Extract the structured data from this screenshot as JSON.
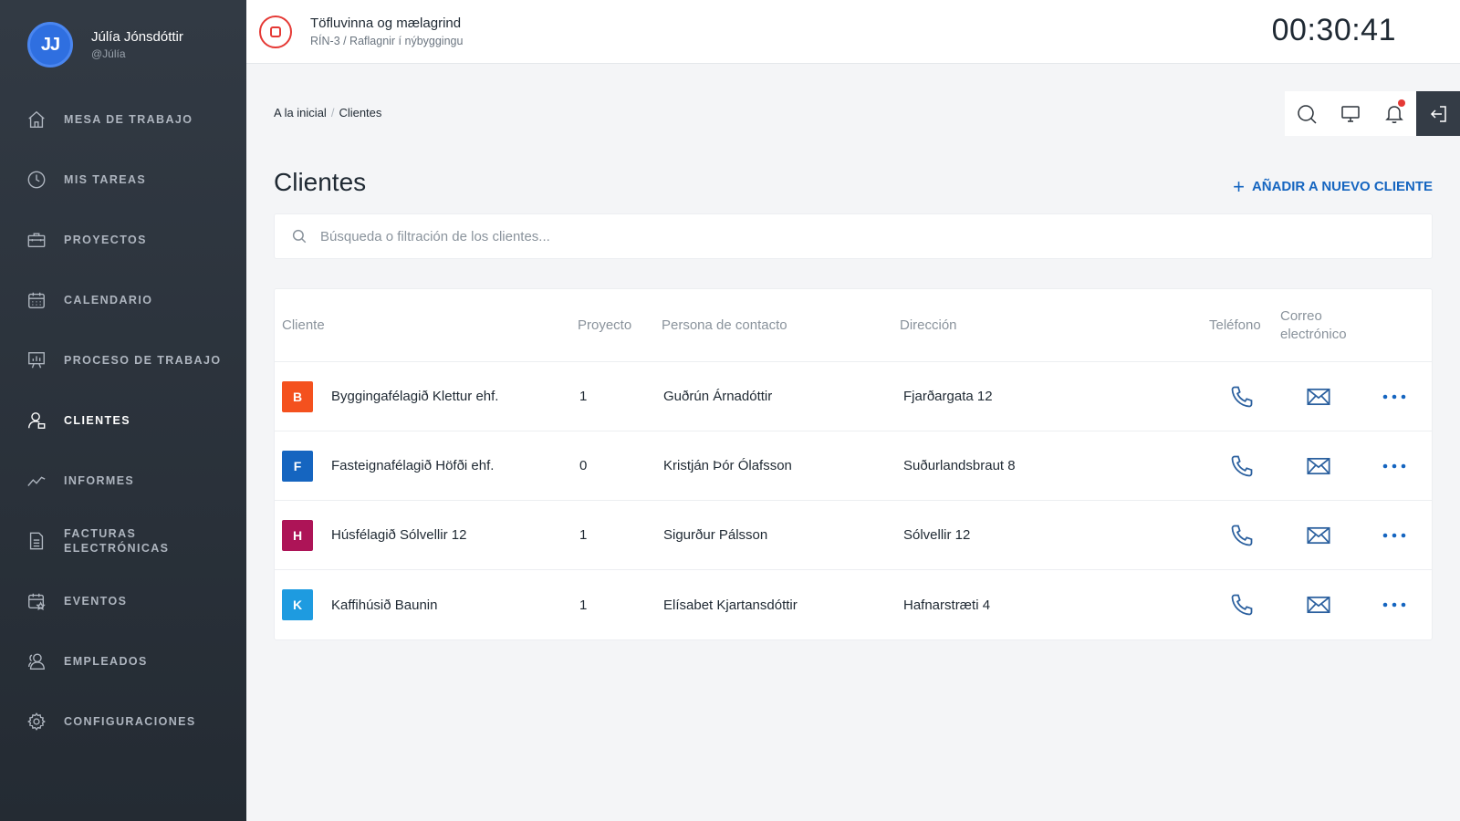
{
  "user": {
    "initials": "JJ",
    "name": "Júlía Jónsdóttir",
    "handle": "@Júlía"
  },
  "nav": [
    {
      "label": "MESA DE TRABAJO",
      "icon": "home-icon"
    },
    {
      "label": "MIS TAREAS",
      "icon": "clock-icon"
    },
    {
      "label": "PROYECTOS",
      "icon": "briefcase-icon"
    },
    {
      "label": "CALENDARIO",
      "icon": "calendar-icon"
    },
    {
      "label": "PROCESO DE TRABAJO",
      "icon": "presentation-chart-icon"
    },
    {
      "label": "CLIENTES",
      "icon": "user-icon",
      "active": true
    },
    {
      "label": "INFORMES",
      "icon": "trend-line-icon"
    },
    {
      "label": "FACTURAS ELECTRÓNICAS",
      "icon": "document-icon"
    },
    {
      "label": "EVENTOS",
      "icon": "calendar-star-icon"
    },
    {
      "label": "EMPLEADOS",
      "icon": "users-icon"
    },
    {
      "label": "CONFIGURACIONES",
      "icon": "gear-icon"
    }
  ],
  "topbar": {
    "task_title": "Töfluvinna og mælagrind",
    "task_sub": "RÍN-3 / Raflagnir í nýbyggingu",
    "timer": "00:30:41"
  },
  "breadcrumb": {
    "home": "A la inicial",
    "current": "Clientes"
  },
  "page": {
    "title": "Clientes",
    "add_label": "AÑADIR A NUEVO CLIENTE",
    "search_placeholder": "Búsqueda o filtración de los clientes..."
  },
  "table": {
    "headers": {
      "client": "Cliente",
      "project": "Proyecto",
      "contact": "Persona de contacto",
      "address": "Dirección",
      "phone": "Teléfono",
      "email": "Correo electrónico"
    },
    "rows": [
      {
        "initial": "B",
        "color": "#f4511e",
        "name": "Byggingafélagið Klettur ehf.",
        "project": "1",
        "contact": "Guðrún Árnadóttir",
        "address": "Fjarðargata 12"
      },
      {
        "initial": "F",
        "color": "#1565c0",
        "name": "Fasteignafélagið Höfði ehf.",
        "project": "0",
        "contact": "Kristján Þór Ólafsson",
        "address": "Suðurlandsbraut 8"
      },
      {
        "initial": "H",
        "color": "#ad1457",
        "name": "Húsfélagið Sólvellir 12",
        "project": "1",
        "contact": "Sigurður Pálsson",
        "address": "Sólvellir 12"
      },
      {
        "initial": "K",
        "color": "#1e9be0",
        "name": "Kaffihúsið Baunin",
        "project": "1",
        "contact": "Elísabet Kjartansdóttir",
        "address": "Hafnarstræti 4"
      }
    ]
  },
  "colors": {
    "accent": "#1565c0",
    "danger": "#e53935",
    "sidebar": "#2c333c"
  }
}
